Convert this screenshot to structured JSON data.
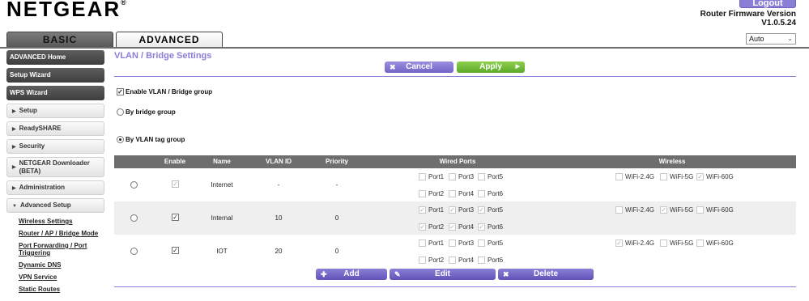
{
  "header": {
    "logo": "NETGEAR",
    "logo_mark": "®",
    "logout": "Logout",
    "fw_label": "Router Firmware Version",
    "fw_version": "V1.0.5.24",
    "language": "Auto"
  },
  "tabs": {
    "basic": "BASIC",
    "advanced": "ADVANCED"
  },
  "sidebar": {
    "dark": [
      "ADVANCED Home",
      "Setup Wizard",
      "WPS Wizard"
    ],
    "light": [
      "Setup",
      "ReadySHARE",
      "Security"
    ],
    "downloader": [
      "NETGEAR Downloader",
      "(BETA)"
    ],
    "administration": "Administration",
    "advanced_setup": "Advanced Setup",
    "subs": [
      "Wireless Settings",
      "Router / AP / Bridge Mode",
      "Port Forwarding / Port",
      "Triggering",
      "Dynamic DNS",
      "VPN Service",
      "Static Routes"
    ]
  },
  "main": {
    "title": "VLAN / Bridge Settings",
    "cancel": "Cancel",
    "apply": "Apply",
    "enable_group": "Enable VLAN / Bridge group",
    "by_bridge": "By bridge group",
    "by_vlan": "By VLAN tag group",
    "columns": [
      "Enable",
      "Name",
      "VLAN ID",
      "Priority",
      "Wired Ports",
      "Wireless"
    ],
    "ports": [
      "Port1",
      "Port3",
      "Port5",
      "Port2",
      "Port4",
      "Port6"
    ],
    "wireless": [
      "WiFi-2.4G",
      "WiFi-5G",
      "WiFi-60G"
    ],
    "rows": [
      {
        "name": "Internet",
        "vlan_id": "-",
        "priority": "-"
      },
      {
        "name": "Internal",
        "vlan_id": "10",
        "priority": "0"
      },
      {
        "name": "IOT",
        "vlan_id": "20",
        "priority": "0"
      }
    ],
    "add": "Add",
    "edit": "Edit",
    "delete": "Delete"
  }
}
